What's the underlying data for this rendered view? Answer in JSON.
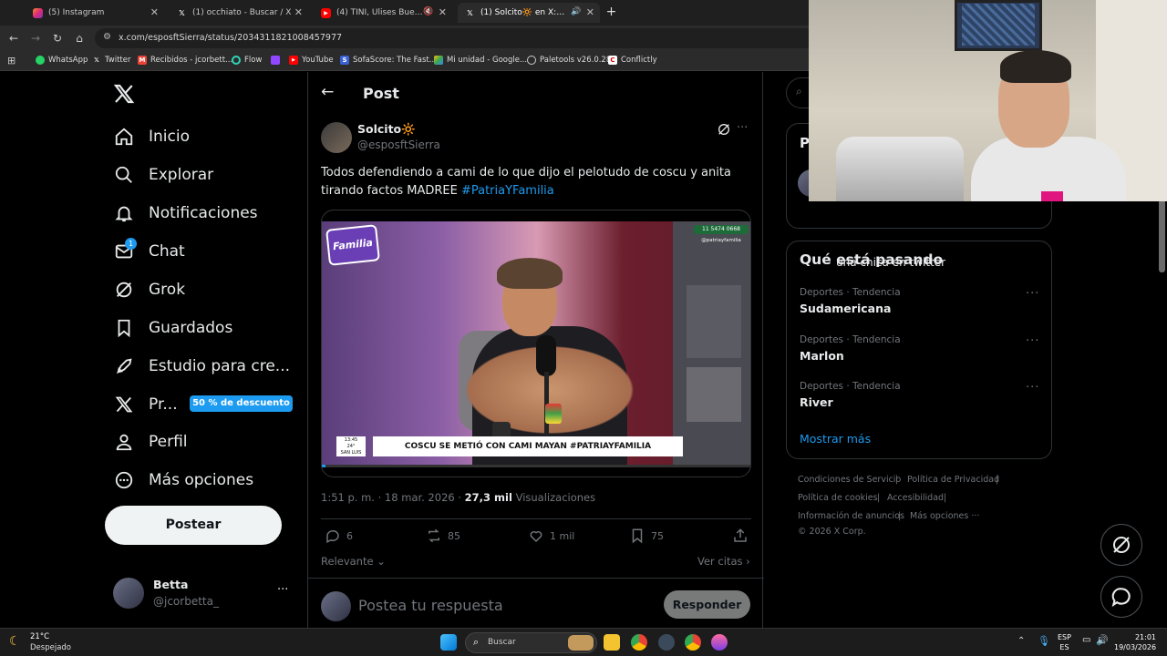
{
  "browser": {
    "tabs": [
      {
        "label": "(5) Instagram",
        "active": false
      },
      {
        "label": "(1) occhiato - Buscar / X",
        "active": false
      },
      {
        "label": "(4) TINI, Ulises Bueno - Do:",
        "active": false
      },
      {
        "label": "(1) Solcito🔆 en X: \"Todos d",
        "active": true
      }
    ],
    "url": "x.com/esposftSierra/status/2034311821008457977",
    "bookmarks": [
      "WhatsApp",
      "Twitter",
      "Recibidos - jcorbett...",
      "Flow",
      "YouTube",
      "SofaScore: The Fast...",
      "Mi unidad - Google...",
      "Paletools v26.0.28",
      "Conflictly"
    ]
  },
  "sidebar": {
    "nav": [
      {
        "label": "Inicio",
        "icon": "home-icon"
      },
      {
        "label": "Explorar",
        "icon": "search-icon"
      },
      {
        "label": "Notificaciones",
        "icon": "bell-icon"
      },
      {
        "label": "Chat",
        "icon": "mail-icon"
      },
      {
        "label": "Grok",
        "icon": "grok-icon"
      },
      {
        "label": "Guardados",
        "icon": "bookmark-icon"
      },
      {
        "label": "Estudio para cre...",
        "icon": "rocket-icon"
      },
      {
        "label": "Pr...",
        "icon": "x-logo-icon"
      },
      {
        "label": "Perfil",
        "icon": "person-icon"
      },
      {
        "label": "Más opciones",
        "icon": "more-circle-icon"
      }
    ],
    "chat_badge": "1",
    "premium_promo": "50 % de descuento",
    "post_button": "Postear",
    "user": {
      "name": "Betta",
      "handle": "@jcorbetta_",
      "more": "···"
    }
  },
  "post": {
    "header_title": "Post",
    "author_name": "Solcito🔆",
    "author_handle": "@esposftSierra",
    "text": "Todos defendiendo a cami de lo que dijo el pelotudo de coscu y anita tirando factos MADREE ",
    "hashtag": "#PatriaYFamilia",
    "video_banner": "COSCU SE METIÓ CON CAMI MAYAN #PATRIAYFAMILIA",
    "video_logo": "Familia",
    "video_phone": "11 5474 0668",
    "video_handle": "@patriayfamilia",
    "video_time": "13:45",
    "video_temp": "24°",
    "video_city": "SAN LUIS",
    "time": "1:51 p. m. · 18 mar. 2026 · ",
    "views_count": "27,3 mil",
    "views_label": " Visualizaciones",
    "replies": "6",
    "reposts": "85",
    "likes": "1 mil",
    "bookmarks": "75",
    "sort_label": "Relevante",
    "quotes_label": "Ver citas",
    "reply_placeholder": "Postea tu respuesta",
    "reply_button": "Responder"
  },
  "right": {
    "card_partial_letter": "P",
    "card_partial_text": "una chica en twitter",
    "trends_title": "Qué está pasando",
    "trends": [
      {
        "meta": "Deportes · Tendencia",
        "name": "Sudamericana"
      },
      {
        "meta": "Deportes · Tendencia",
        "name": "Marlon"
      },
      {
        "meta": "Deportes · Tendencia",
        "name": "River"
      }
    ],
    "show_more": "Mostrar más",
    "footer": [
      "Condiciones de Servicio",
      "Política de Privacidad",
      "Política de cookies",
      "Accesibilidad",
      "Información de anuncios",
      "Más opciones ···",
      "© 2026 X Corp."
    ]
  },
  "taskbar": {
    "weather_temp": "21°C",
    "weather_desc": "Despejado",
    "search_placeholder": "Buscar",
    "lang_top": "ESP",
    "lang_bottom": "ES",
    "clock_time": "21:01",
    "clock_date": "19/03/2026"
  },
  "colors": {
    "accent": "#1d9bf0",
    "background": "#000000",
    "border": "#2f3336",
    "muted": "#71767b"
  }
}
